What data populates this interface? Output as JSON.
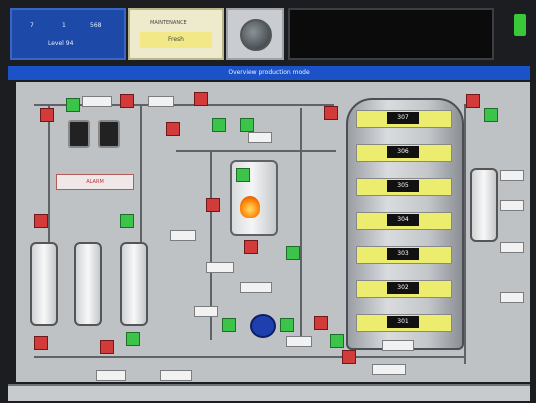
{
  "header": {
    "counter_a": "7",
    "counter_b": "1",
    "counter_c": "568",
    "blue_label": "Level 94",
    "yellow_title": "MAINTENANCE",
    "yellow_status": "Fresh"
  },
  "banner": "Overview production mode",
  "silo": {
    "tags": [
      "307",
      "306",
      "305",
      "304",
      "303",
      "302",
      "301"
    ],
    "yellow_rows": 7
  },
  "alerts": {
    "warning_label": "ALARM"
  },
  "colors": {
    "accent_blue": "#1c52c8",
    "valve_red": "#d33a3a",
    "valve_green": "#3cc44a",
    "indicator_yellow": "#ecec6e"
  }
}
